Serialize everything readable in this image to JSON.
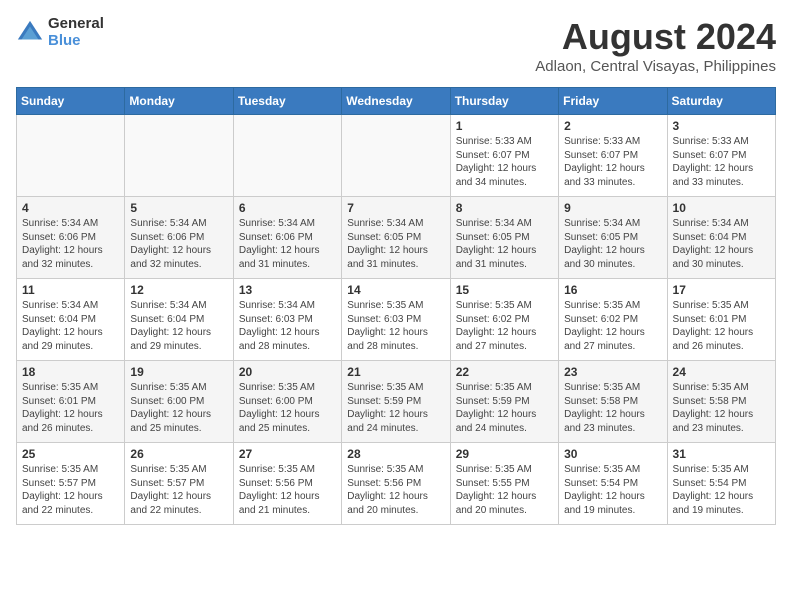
{
  "header": {
    "logo_general": "General",
    "logo_blue": "Blue",
    "title": "August 2024",
    "location": "Adlaon, Central Visayas, Philippines"
  },
  "calendar": {
    "days_of_week": [
      "Sunday",
      "Monday",
      "Tuesday",
      "Wednesday",
      "Thursday",
      "Friday",
      "Saturday"
    ],
    "weeks": [
      [
        {
          "day": "",
          "info": ""
        },
        {
          "day": "",
          "info": ""
        },
        {
          "day": "",
          "info": ""
        },
        {
          "day": "",
          "info": ""
        },
        {
          "day": "1",
          "info": "Sunrise: 5:33 AM\nSunset: 6:07 PM\nDaylight: 12 hours\nand 34 minutes."
        },
        {
          "day": "2",
          "info": "Sunrise: 5:33 AM\nSunset: 6:07 PM\nDaylight: 12 hours\nand 33 minutes."
        },
        {
          "day": "3",
          "info": "Sunrise: 5:33 AM\nSunset: 6:07 PM\nDaylight: 12 hours\nand 33 minutes."
        }
      ],
      [
        {
          "day": "4",
          "info": "Sunrise: 5:34 AM\nSunset: 6:06 PM\nDaylight: 12 hours\nand 32 minutes."
        },
        {
          "day": "5",
          "info": "Sunrise: 5:34 AM\nSunset: 6:06 PM\nDaylight: 12 hours\nand 32 minutes."
        },
        {
          "day": "6",
          "info": "Sunrise: 5:34 AM\nSunset: 6:06 PM\nDaylight: 12 hours\nand 31 minutes."
        },
        {
          "day": "7",
          "info": "Sunrise: 5:34 AM\nSunset: 6:05 PM\nDaylight: 12 hours\nand 31 minutes."
        },
        {
          "day": "8",
          "info": "Sunrise: 5:34 AM\nSunset: 6:05 PM\nDaylight: 12 hours\nand 31 minutes."
        },
        {
          "day": "9",
          "info": "Sunrise: 5:34 AM\nSunset: 6:05 PM\nDaylight: 12 hours\nand 30 minutes."
        },
        {
          "day": "10",
          "info": "Sunrise: 5:34 AM\nSunset: 6:04 PM\nDaylight: 12 hours\nand 30 minutes."
        }
      ],
      [
        {
          "day": "11",
          "info": "Sunrise: 5:34 AM\nSunset: 6:04 PM\nDaylight: 12 hours\nand 29 minutes."
        },
        {
          "day": "12",
          "info": "Sunrise: 5:34 AM\nSunset: 6:04 PM\nDaylight: 12 hours\nand 29 minutes."
        },
        {
          "day": "13",
          "info": "Sunrise: 5:34 AM\nSunset: 6:03 PM\nDaylight: 12 hours\nand 28 minutes."
        },
        {
          "day": "14",
          "info": "Sunrise: 5:35 AM\nSunset: 6:03 PM\nDaylight: 12 hours\nand 28 minutes."
        },
        {
          "day": "15",
          "info": "Sunrise: 5:35 AM\nSunset: 6:02 PM\nDaylight: 12 hours\nand 27 minutes."
        },
        {
          "day": "16",
          "info": "Sunrise: 5:35 AM\nSunset: 6:02 PM\nDaylight: 12 hours\nand 27 minutes."
        },
        {
          "day": "17",
          "info": "Sunrise: 5:35 AM\nSunset: 6:01 PM\nDaylight: 12 hours\nand 26 minutes."
        }
      ],
      [
        {
          "day": "18",
          "info": "Sunrise: 5:35 AM\nSunset: 6:01 PM\nDaylight: 12 hours\nand 26 minutes."
        },
        {
          "day": "19",
          "info": "Sunrise: 5:35 AM\nSunset: 6:00 PM\nDaylight: 12 hours\nand 25 minutes."
        },
        {
          "day": "20",
          "info": "Sunrise: 5:35 AM\nSunset: 6:00 PM\nDaylight: 12 hours\nand 25 minutes."
        },
        {
          "day": "21",
          "info": "Sunrise: 5:35 AM\nSunset: 5:59 PM\nDaylight: 12 hours\nand 24 minutes."
        },
        {
          "day": "22",
          "info": "Sunrise: 5:35 AM\nSunset: 5:59 PM\nDaylight: 12 hours\nand 24 minutes."
        },
        {
          "day": "23",
          "info": "Sunrise: 5:35 AM\nSunset: 5:58 PM\nDaylight: 12 hours\nand 23 minutes."
        },
        {
          "day": "24",
          "info": "Sunrise: 5:35 AM\nSunset: 5:58 PM\nDaylight: 12 hours\nand 23 minutes."
        }
      ],
      [
        {
          "day": "25",
          "info": "Sunrise: 5:35 AM\nSunset: 5:57 PM\nDaylight: 12 hours\nand 22 minutes."
        },
        {
          "day": "26",
          "info": "Sunrise: 5:35 AM\nSunset: 5:57 PM\nDaylight: 12 hours\nand 22 minutes."
        },
        {
          "day": "27",
          "info": "Sunrise: 5:35 AM\nSunset: 5:56 PM\nDaylight: 12 hours\nand 21 minutes."
        },
        {
          "day": "28",
          "info": "Sunrise: 5:35 AM\nSunset: 5:56 PM\nDaylight: 12 hours\nand 20 minutes."
        },
        {
          "day": "29",
          "info": "Sunrise: 5:35 AM\nSunset: 5:55 PM\nDaylight: 12 hours\nand 20 minutes."
        },
        {
          "day": "30",
          "info": "Sunrise: 5:35 AM\nSunset: 5:54 PM\nDaylight: 12 hours\nand 19 minutes."
        },
        {
          "day": "31",
          "info": "Sunrise: 5:35 AM\nSunset: 5:54 PM\nDaylight: 12 hours\nand 19 minutes."
        }
      ]
    ]
  }
}
